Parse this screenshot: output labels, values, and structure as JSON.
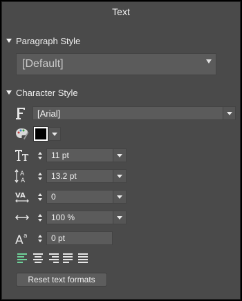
{
  "panel": {
    "title": "Text"
  },
  "paragraph": {
    "section_label": "Paragraph Style",
    "style_value": "[Default]"
  },
  "character": {
    "section_label": "Character Style",
    "font_value": "[Arial]",
    "font_size": "11 pt",
    "line_height": "13.2 pt",
    "tracking": "0",
    "horizontal_scale": "100 %",
    "baseline_shift": "0 pt",
    "text_color": "#000000"
  },
  "alignment": {
    "options": [
      "align-left",
      "align-center",
      "align-right",
      "justify",
      "justify-all"
    ],
    "active": "align-left",
    "active_color": "#6fd39a"
  },
  "actions": {
    "reset_label": "Reset text formats"
  }
}
